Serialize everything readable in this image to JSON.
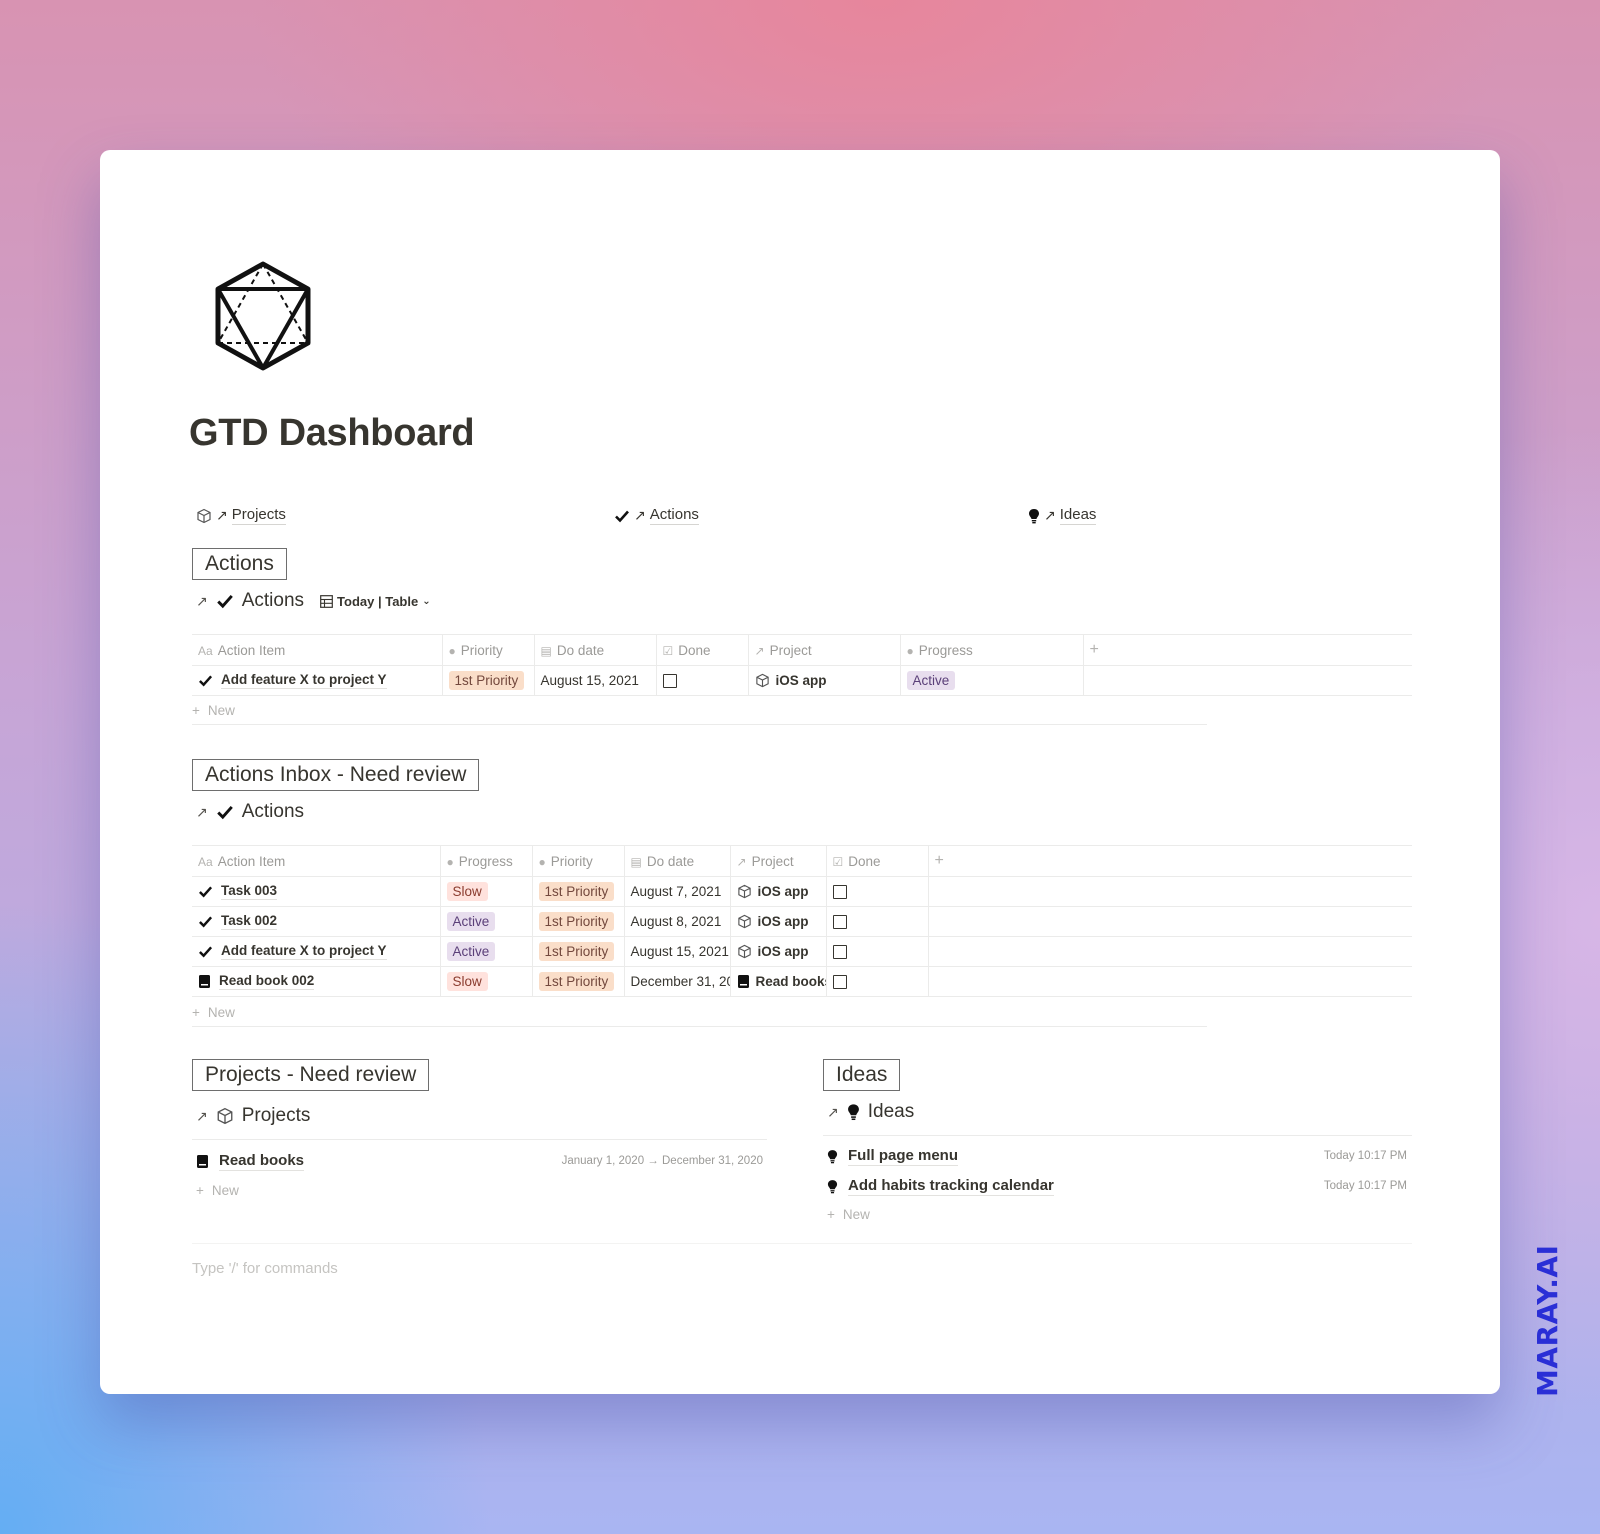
{
  "page": {
    "title": "GTD Dashboard",
    "icon": "icosahedron-icon"
  },
  "quick_links": [
    {
      "icon": "cube-icon",
      "label": "Projects"
    },
    {
      "icon": "checkmark-icon",
      "label": "Actions"
    },
    {
      "icon": "lightbulb-icon",
      "label": "Ideas"
    }
  ],
  "sections": {
    "actions": {
      "callout": "Actions",
      "db_title": "Actions",
      "view": "Today | Table",
      "columns": [
        "Action Item",
        "Priority",
        "Do date",
        "Done",
        "Project",
        "Progress"
      ],
      "rows": [
        {
          "title": "Add feature X to project Y",
          "priority": "1st Priority",
          "do_date": "August 15, 2021",
          "done": false,
          "project": "iOS app",
          "progress": "Active"
        }
      ],
      "new_label": "New"
    },
    "inbox": {
      "callout": "Actions Inbox - Need review",
      "db_title": "Actions",
      "columns": [
        "Action Item",
        "Progress",
        "Priority",
        "Do date",
        "Project",
        "Done"
      ],
      "rows": [
        {
          "icon": "checkmark-icon",
          "title": "Task 003",
          "progress": "Slow",
          "priority": "1st Priority",
          "do_date": "August 7, 2021",
          "project_icon": "cube-icon",
          "project": "iOS app",
          "done": false
        },
        {
          "icon": "checkmark-icon",
          "title": "Task 002",
          "progress": "Active",
          "priority": "1st Priority",
          "do_date": "August 8, 2021",
          "project_icon": "cube-icon",
          "project": "iOS app",
          "done": false
        },
        {
          "icon": "checkmark-icon",
          "title": "Add feature X to project Y",
          "progress": "Active",
          "priority": "1st Priority",
          "do_date": "August 15, 2021",
          "project_icon": "cube-icon",
          "project": "iOS app",
          "done": false
        },
        {
          "icon": "book-icon",
          "title": "Read book 002",
          "progress": "Slow",
          "priority": "1st Priority",
          "do_date": "December 31, 20",
          "project_icon": "book-icon",
          "project": "Read books",
          "done": false
        }
      ],
      "new_label": "New"
    },
    "projects": {
      "callout": "Projects - Need review",
      "db_title": "Projects",
      "items": [
        {
          "title": "Read books",
          "dates": "January 1, 2020 → December 31, 2020"
        }
      ],
      "new_label": "New"
    },
    "ideas": {
      "callout": "Ideas",
      "db_title": "Ideas",
      "items": [
        {
          "title": "Full page menu",
          "time": "Today 10:17 PM"
        },
        {
          "title": "Add habits tracking calendar",
          "time": "Today 10:17 PM"
        }
      ],
      "new_label": "New"
    }
  },
  "command_placeholder": "Type '/' for commands",
  "watermark": "MARAY.AI",
  "colors": {
    "priority_tag": "#fadec9",
    "slow_tag": "#ffe2dd",
    "active_tag": "#e8deee",
    "watermark": "#2a2fd6"
  }
}
